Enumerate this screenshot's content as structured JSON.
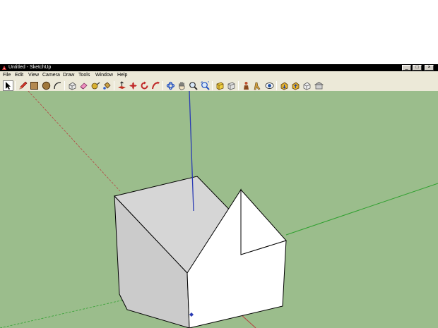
{
  "window": {
    "title": "Untitled - SketchUp",
    "minimize_glyph": "_",
    "maximize_glyph": "□",
    "close_glyph": "×"
  },
  "menu": {
    "items": [
      "File",
      "Edit",
      "View",
      "Camera",
      "Draw",
      "Tools",
      "Window",
      "Help"
    ]
  },
  "toolbar": {
    "tools": [
      {
        "name": "select-tool",
        "icon": "arrow-icon",
        "active": true
      },
      {
        "name": "line-tool",
        "icon": "pencil-icon"
      },
      {
        "name": "rectangle-tool",
        "icon": "rectangle-icon"
      },
      {
        "name": "circle-tool",
        "icon": "circle-icon"
      },
      {
        "name": "arc-tool",
        "icon": "arc-icon"
      },
      {
        "name": "make-component-tool",
        "icon": "component-icon"
      },
      {
        "name": "eraser-tool",
        "icon": "eraser-icon"
      },
      {
        "name": "tape-measure-tool",
        "icon": "tape-measure-icon"
      },
      {
        "name": "paint-bucket-tool",
        "icon": "paint-bucket-icon"
      },
      {
        "name": "push-pull-tool",
        "icon": "push-pull-icon"
      },
      {
        "name": "move-tool",
        "icon": "move-icon"
      },
      {
        "name": "rotate-tool",
        "icon": "rotate-icon"
      },
      {
        "name": "follow-me-tool",
        "icon": "follow-me-icon"
      },
      {
        "name": "orbit-tool",
        "icon": "orbit-icon"
      },
      {
        "name": "pan-tool",
        "icon": "hand-icon"
      },
      {
        "name": "zoom-tool",
        "icon": "zoom-icon"
      },
      {
        "name": "zoom-extents-tool",
        "icon": "zoom-extents-icon"
      },
      {
        "name": "previous-view-tool",
        "icon": "previous-view-icon"
      },
      {
        "name": "next-view-tool",
        "icon": "next-view-icon"
      },
      {
        "name": "position-camera-tool",
        "icon": "position-camera-icon"
      },
      {
        "name": "walk-tool",
        "icon": "walk-icon"
      },
      {
        "name": "look-around-tool",
        "icon": "look-around-icon"
      },
      {
        "name": "get-models-tool",
        "icon": "get-models-icon"
      },
      {
        "name": "share-model-tool",
        "icon": "share-model-icon"
      },
      {
        "name": "share-component-tool",
        "icon": "share-component-icon"
      },
      {
        "name": "extension-warehouse-tool",
        "icon": "warehouse-icon"
      }
    ]
  },
  "colors": {
    "sky": "#ffffff",
    "ground": "#9bbd8c",
    "axis_blue": "#2a3bb4",
    "axis_green": "#2fa02f",
    "axis_red": "#b84040",
    "roof_top": "#d6d6d6",
    "side_face": "#cbcbcb",
    "front_face": "#ffffff",
    "edge": "#000000"
  }
}
